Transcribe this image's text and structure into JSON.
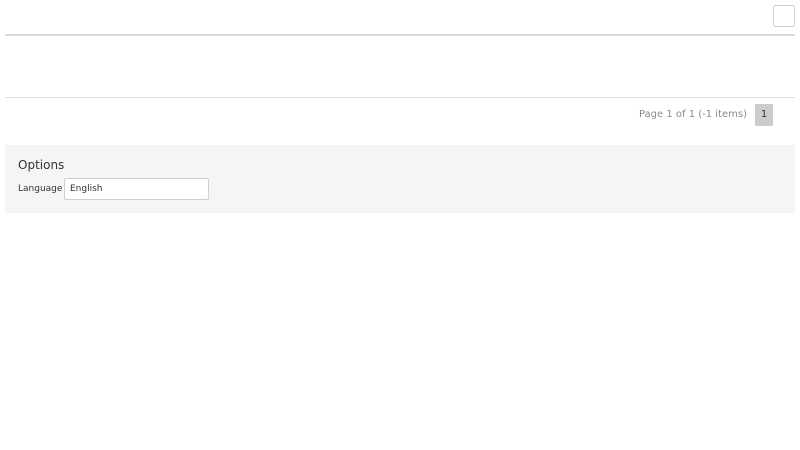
{
  "pager": {
    "info": "Page 1 of 1 (-1 items)",
    "current_page": "1"
  },
  "options": {
    "title": "Options",
    "language_label": "Language",
    "language_value": "English"
  }
}
